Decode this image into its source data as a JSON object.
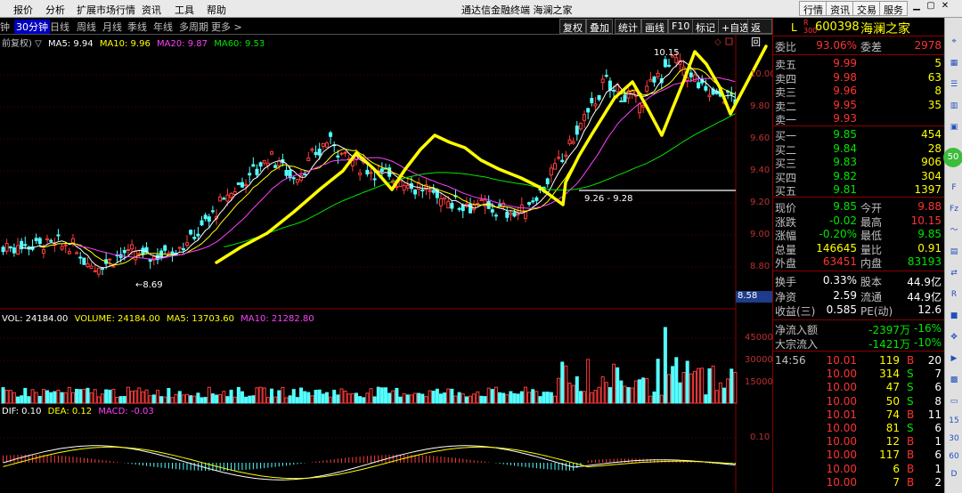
{
  "menu": [
    "报价",
    "分析",
    "扩展市场行情",
    "资讯",
    "工具",
    "帮助"
  ],
  "app_title": "通达信金融终端 海澜之家",
  "top_buttons": [
    "行情",
    "资讯",
    "交易",
    "服务"
  ],
  "window_controls": [
    "minimize-icon",
    "maximize-icon",
    "close-icon"
  ],
  "period_tabs": [
    "钟",
    "30分钟",
    "日线",
    "周线",
    "月线",
    "季线",
    "年线",
    "多周期",
    "更多 >"
  ],
  "active_period": "30分钟",
  "chart_tools": [
    "复权",
    "叠加",
    "统计",
    "画线",
    "F10",
    "标记",
    "+自选",
    "返回"
  ],
  "ma_line": {
    "prefix": "前复权) ▽",
    "items": [
      {
        "label": "MA5: 9.94",
        "color": "#ffffff"
      },
      {
        "label": "MA10: 9.96",
        "color": "#ffff00"
      },
      {
        "label": "MA20: 9.87",
        "color": "#ff40ff"
      },
      {
        "label": "MA60: 9.53",
        "color": "#00e600"
      }
    ]
  },
  "vol_line": {
    "items": [
      {
        "label": "VOL: 24184.00",
        "color": "#ffffff"
      },
      {
        "label": "VOLUME: 24184.00",
        "color": "#ffff00"
      },
      {
        "label": "MA5: 13703.60",
        "color": "#ffff00"
      },
      {
        "label": "MA10: 21282.80",
        "color": "#ff40ff"
      }
    ]
  },
  "macd_line": {
    "items": [
      {
        "label": "DIF: 0.10",
        "color": "#ffffff"
      },
      {
        "label": "DEA: 0.12",
        "color": "#ffff00"
      },
      {
        "label": "MACD: -0.03",
        "color": "#ff40ff"
      }
    ]
  },
  "price_axis": [
    "10.00",
    "9.80",
    "9.60",
    "9.40",
    "9.20",
    "9.00",
    "8.80"
  ],
  "price_current_box": "8.58",
  "vol_axis": [
    "45000",
    "30000",
    "15000"
  ],
  "macd_axis": [
    "0.10"
  ],
  "annotations": {
    "high": "10.15",
    "low": "8.69",
    "range": "9.26 - 9.28"
  },
  "stock": {
    "prefix": "L",
    "tag": "R 300",
    "code": "600398",
    "name": "海澜之家"
  },
  "quote_top": {
    "label1": "委比",
    "value1": "93.06%",
    "label2": "委差",
    "value2": "2978"
  },
  "asks": [
    {
      "label": "卖五",
      "price": "9.99",
      "vol": "5"
    },
    {
      "label": "卖四",
      "price": "9.98",
      "vol": "63"
    },
    {
      "label": "卖三",
      "price": "9.96",
      "vol": "8"
    },
    {
      "label": "卖二",
      "price": "9.95",
      "vol": "35"
    },
    {
      "label": "卖一",
      "price": "9.93",
      "vol": ""
    }
  ],
  "bids": [
    {
      "label": "买一",
      "price": "9.85",
      "vol": "454"
    },
    {
      "label": "买二",
      "price": "9.84",
      "vol": "28"
    },
    {
      "label": "买三",
      "price": "9.83",
      "vol": "906"
    },
    {
      "label": "买四",
      "price": "9.82",
      "vol": "304"
    },
    {
      "label": "买五",
      "price": "9.81",
      "vol": "1397"
    }
  ],
  "stats": [
    {
      "l1": "现价",
      "v1": "9.85",
      "c1": "green",
      "l2": "今开",
      "v2": "9.88",
      "c2": "red"
    },
    {
      "l1": "涨跌",
      "v1": "-0.02",
      "c1": "green",
      "l2": "最高",
      "v2": "10.15",
      "c2": "red"
    },
    {
      "l1": "涨幅",
      "v1": "-0.20%",
      "c1": "green",
      "l2": "最低",
      "v2": "9.85",
      "c2": "green"
    },
    {
      "l1": "总量",
      "v1": "146645",
      "c1": "yellow",
      "l2": "量比",
      "v2": "0.91",
      "c2": "yellow"
    },
    {
      "l1": "外盘",
      "v1": "63451",
      "c1": "red",
      "l2": "内盘",
      "v2": "83193",
      "c2": "green"
    }
  ],
  "stats2": [
    {
      "l1": "换手",
      "v1": "0.33%",
      "c1": "white",
      "l2": "股本",
      "v2": "44.9亿",
      "c2": "white"
    },
    {
      "l1": "净资",
      "v1": "2.59",
      "c1": "white",
      "l2": "流通",
      "v2": "44.9亿",
      "c2": "white"
    },
    {
      "l1": "收益(三)",
      "v1": "0.585",
      "c1": "white",
      "l2": "PE(动)",
      "v2": "12.6",
      "c2": "white"
    }
  ],
  "flows": [
    {
      "label": "净流入额",
      "value": "-2397万",
      "pct": "-16%"
    },
    {
      "label": "大宗流入",
      "value": "-1421万",
      "pct": "-10%"
    }
  ],
  "ticks": [
    {
      "time": "14:56",
      "price": "10.01",
      "vol": "119",
      "side": "B",
      "n": "20"
    },
    {
      "time": "",
      "price": "10.00",
      "vol": "314",
      "side": "S",
      "n": "7"
    },
    {
      "time": "",
      "price": "10.00",
      "vol": "47",
      "side": "S",
      "n": "6"
    },
    {
      "time": "",
      "price": "10.00",
      "vol": "50",
      "side": "S",
      "n": "8"
    },
    {
      "time": "",
      "price": "10.01",
      "vol": "74",
      "side": "B",
      "n": "11"
    },
    {
      "time": "",
      "price": "10.00",
      "vol": "81",
      "side": "S",
      "n": "6"
    },
    {
      "time": "",
      "price": "10.00",
      "vol": "12",
      "side": "B",
      "n": "1"
    },
    {
      "time": "",
      "price": "10.00",
      "vol": "117",
      "side": "B",
      "n": "6"
    },
    {
      "time": "",
      "price": "10.00",
      "vol": "6",
      "side": "B",
      "n": "1"
    },
    {
      "time": "",
      "price": "10.00",
      "vol": "7",
      "side": "B",
      "n": "2"
    }
  ],
  "sidebar_icons": [
    "50"
  ]
}
